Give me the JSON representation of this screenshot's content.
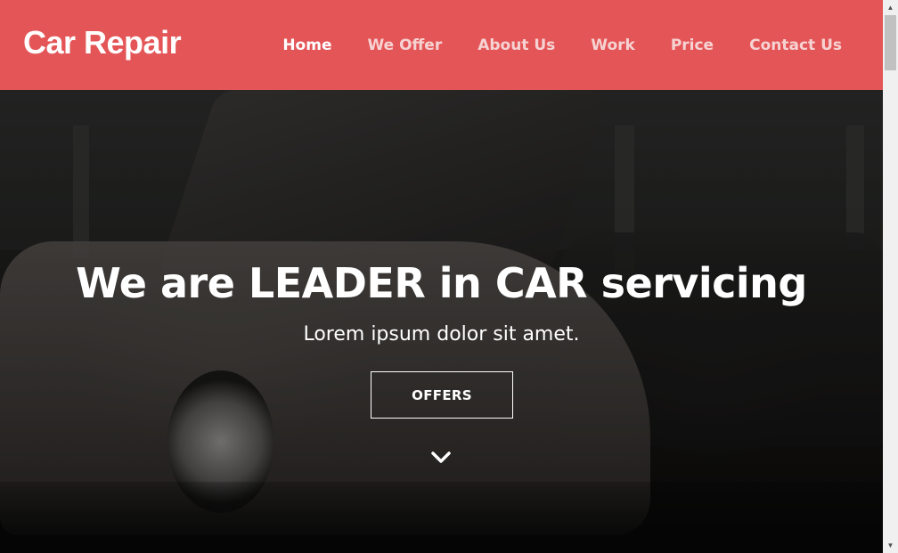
{
  "header": {
    "brand": "Car Repair",
    "nav": [
      {
        "label": "Home",
        "active": true
      },
      {
        "label": "We Offer",
        "active": false
      },
      {
        "label": "About Us",
        "active": false
      },
      {
        "label": "Work",
        "active": false
      },
      {
        "label": "Price",
        "active": false
      },
      {
        "label": "Contact Us",
        "active": false
      }
    ]
  },
  "hero": {
    "title": "We are LEADER in CAR servicing",
    "subtitle": "Lorem ipsum dolor sit amet.",
    "button_label": "OFFERS",
    "scroll_icon": "chevron-down-icon"
  },
  "colors": {
    "header_bg": "#e45557",
    "text": "#ffffff"
  }
}
